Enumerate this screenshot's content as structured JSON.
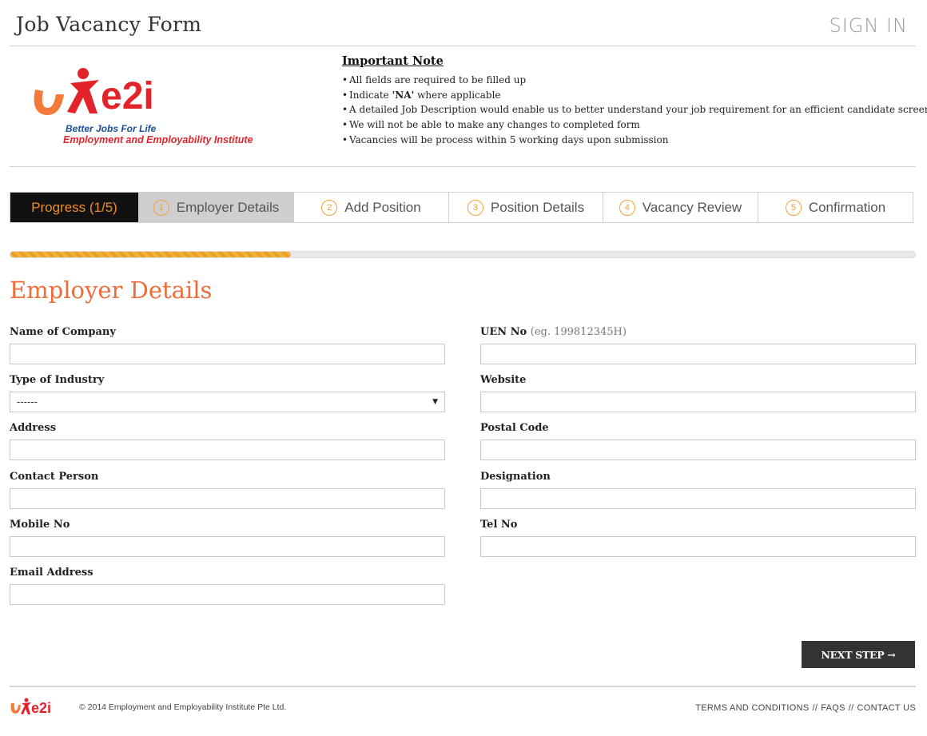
{
  "header": {
    "title": "Job Vacancy Form",
    "sign_in": "SIGN IN"
  },
  "logo": {
    "tagline1": "Better Jobs For Life",
    "tagline2": "Employment and Employability Institute",
    "colors": {
      "orange": "#f47a3a",
      "red": "#e2232a",
      "blue": "#1a4f9c"
    }
  },
  "note": {
    "title": "Important Note",
    "items": [
      "All fields are required to be filled up",
      "where applicable",
      "A detailed Job Description would enable us to better understand your job requirement for an efficient candidate screening",
      "We will not be able to make any changes to completed form",
      "Vacancies will be process within 5 working days upon submission"
    ],
    "indicate_prefix": "Indicate",
    "indicate_bold": "'NA'"
  },
  "progress": {
    "label": "Progress (1/5)",
    "value": 0.31,
    "steps": [
      {
        "num": "1",
        "label": "Employer Details"
      },
      {
        "num": "2",
        "label": "Add Position"
      },
      {
        "num": "3",
        "label": "Position Details"
      },
      {
        "num": "4",
        "label": "Vacancy Review"
      },
      {
        "num": "5",
        "label": "Confirmation"
      }
    ]
  },
  "form": {
    "section_title": "Employer Details",
    "fields": {
      "company": {
        "label": "Name of Company",
        "value": ""
      },
      "uen": {
        "label": "UEN No",
        "hint": "(eg. 199812345H)",
        "value": ""
      },
      "industry": {
        "label": "Type of Industry",
        "value": "------"
      },
      "website": {
        "label": "Website",
        "value": ""
      },
      "address": {
        "label": "Address",
        "value": ""
      },
      "postal": {
        "label": "Postal Code",
        "value": ""
      },
      "contact": {
        "label": "Contact Person",
        "value": ""
      },
      "designation": {
        "label": "Designation",
        "value": ""
      },
      "mobile": {
        "label": "Mobile No",
        "value": ""
      },
      "tel": {
        "label": "Tel No",
        "value": ""
      },
      "email": {
        "label": "Email Address",
        "value": ""
      }
    },
    "next_button": "NEXT STEP →"
  },
  "footer": {
    "copyright": "© 2014 Employment and Employability Institute Pte Ltd.",
    "links": [
      "TERMS AND CONDITIONS",
      "FAQS",
      "CONTACT US"
    ],
    "separator": "//"
  }
}
